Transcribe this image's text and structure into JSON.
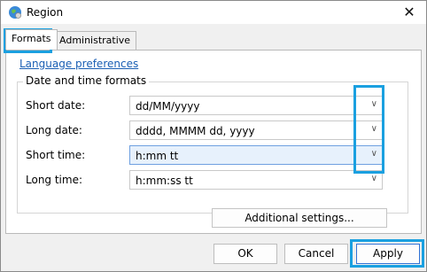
{
  "window": {
    "title": "Region",
    "close_glyph": "✕"
  },
  "tabs": [
    {
      "label": "Formats",
      "active": true
    },
    {
      "label": "Administrative",
      "active": false
    }
  ],
  "panel": {
    "language_link": "Language preferences",
    "group_title": "Date and time formats",
    "rows": [
      {
        "label": "Short date:",
        "value": "dd/MM/yyyy"
      },
      {
        "label": "Long date:",
        "value": "dddd, MMMM dd, yyyy"
      },
      {
        "label": "Short time:",
        "value": "h:mm tt"
      },
      {
        "label": "Long time:",
        "value": "h:mm:ss tt"
      }
    ],
    "additional_settings": "Additional settings..."
  },
  "footer": {
    "ok": "OK",
    "cancel": "Cancel",
    "apply": "Apply"
  },
  "icons": {
    "chevron": "chevron-down-icon",
    "app": "globe-icon"
  },
  "colors": {
    "highlight": "#1aa0e0",
    "link": "#1a5fb4",
    "focus_fill": "#e7f1fc"
  }
}
